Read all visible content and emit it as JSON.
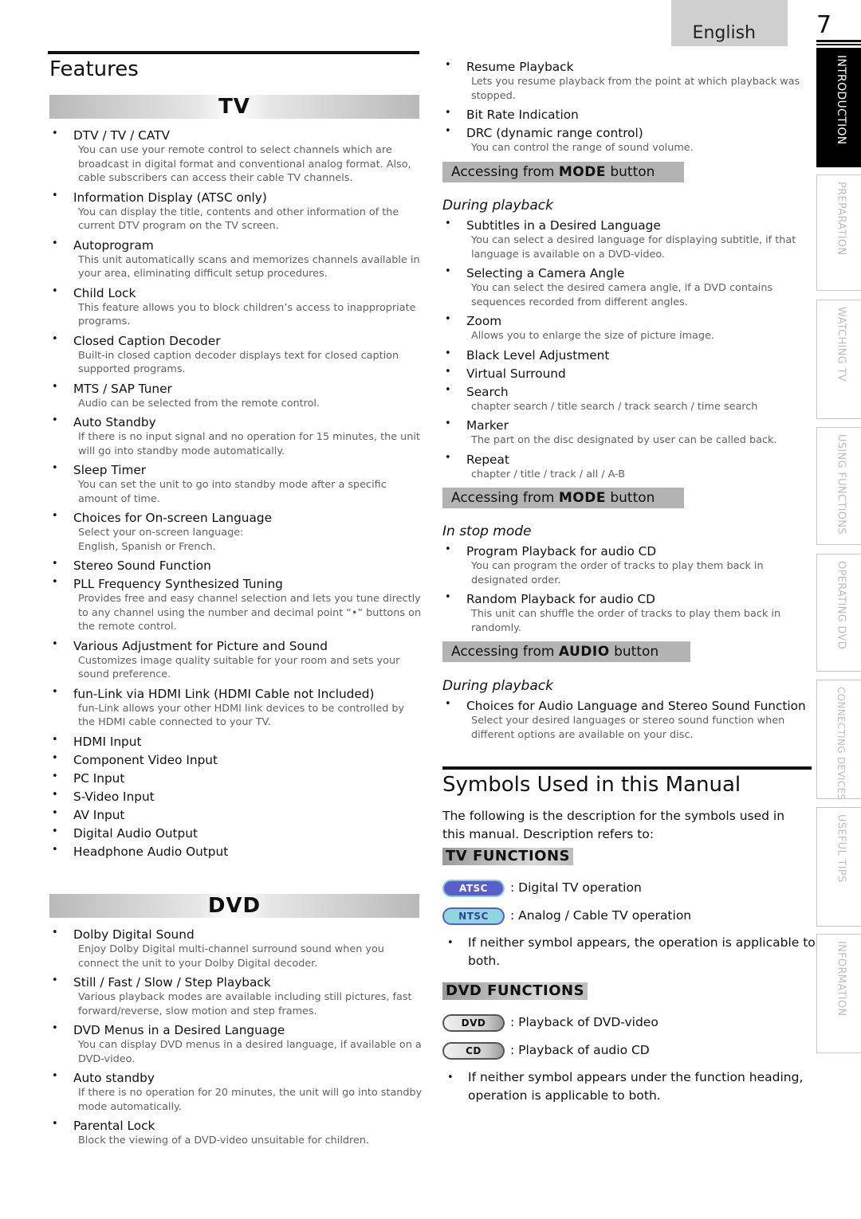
{
  "header": {
    "language_tab": "English",
    "page_number": "7"
  },
  "side_tabs": [
    {
      "label": "INTRODUCTION",
      "active": true
    },
    {
      "label": "PREPARATION",
      "active": false
    },
    {
      "label": "WATCHING TV",
      "active": false
    },
    {
      "label": "USING FUNCTIONS",
      "active": false
    },
    {
      "label": "OPERATING DVD",
      "active": false
    },
    {
      "label": "CONNECTING DEVICES",
      "active": false
    },
    {
      "label": "USEFUL TIPS",
      "active": false
    },
    {
      "label": "INFORMATION",
      "active": false
    }
  ],
  "features": {
    "title": "Features",
    "tv_band": "TV",
    "tv_items": [
      {
        "title": "DTV / TV / CATV",
        "desc": "You can use your remote control to select channels which are broadcast in digital format and conventional analog format. Also, cable subscribers can access their cable TV channels."
      },
      {
        "title": "Information Display",
        "title_extra": " (ATSC only)",
        "desc": "You can display the title, contents and other information of the current DTV program on the TV screen."
      },
      {
        "title": "Autoprogram",
        "desc": "This unit automatically scans and memorizes channels available in your area, eliminating difficult setup procedures."
      },
      {
        "title": "Child Lock",
        "desc": "This feature allows you to block children’s access to inappropriate programs."
      },
      {
        "title": "Closed Caption Decoder",
        "desc": "Built-in closed caption decoder displays text for closed caption supported programs."
      },
      {
        "title": "MTS / SAP Tuner",
        "desc": "Audio can be selected from the remote control."
      },
      {
        "title": "Auto Standby",
        "desc": "If there is no input signal and no operation for 15 minutes, the unit will go into standby mode automatically."
      },
      {
        "title": "Sleep Timer",
        "desc": "You can set the unit to go into standby mode after a specific amount of time."
      },
      {
        "title": "Choices for On-screen Language",
        "desc": "Select your on-screen language:",
        "desc2": "English, Spanish or French."
      },
      {
        "title": "Stereo Sound Function"
      },
      {
        "title": "PLL Frequency Synthesized Tuning",
        "desc": "Provides free and easy channel selection and lets you tune directly to any channel using the number and decimal point “•” buttons on the remote control."
      },
      {
        "title": "Various Adjustment for Picture and Sound",
        "desc": "Customizes image quality suitable for your room and sets your sound preference."
      },
      {
        "title": "fun-Link via HDMI Link",
        "title_extra": " (HDMI Cable not Included)",
        "desc": "fun-Link allows your other HDMI link devices to be controlled by the HDMI cable connected to your TV."
      },
      {
        "title": "HDMI Input"
      },
      {
        "title": "Component Video Input"
      },
      {
        "title": "PC Input"
      },
      {
        "title": "S-Video Input"
      },
      {
        "title": "AV Input"
      },
      {
        "title": "Digital Audio Output"
      },
      {
        "title": "Headphone Audio Output"
      }
    ],
    "dvd_band": "DVD",
    "dvd_items": [
      {
        "title": "Dolby Digital Sound",
        "desc": "Enjoy Dolby Digital multi-channel surround sound when you connect the unit to your Dolby Digital decoder."
      },
      {
        "title": "Still / Fast / Slow / Step Playback",
        "desc": "Various playback modes are available including still pictures, fast forward/reverse, slow motion and step frames."
      },
      {
        "title": "DVD Menus in a Desired Language",
        "desc": "You can display DVD menus in a desired language, if available on a DVD-video."
      },
      {
        "title": "Auto standby",
        "desc": "If there is no operation for 20 minutes, the unit will go into standby mode automatically."
      },
      {
        "title": "Parental Lock",
        "desc": "Block the viewing of a DVD-video unsuitable for children."
      }
    ],
    "dvd_items_cont": [
      {
        "title": "Resume Playback",
        "desc": "Lets you resume playback from the point at which playback was stopped."
      },
      {
        "title": "Bit Rate Indication"
      },
      {
        "title": "DRC (dynamic range control)",
        "desc": "You can control the range of sound volume."
      }
    ],
    "mode_bar_1": {
      "prefix": "Accessing from ",
      "key": "MODE",
      "suffix": " button"
    },
    "during_playback_1": "During playback",
    "mode_items_1": [
      {
        "title": "Subtitles in a Desired Language",
        "desc": "You can select a desired language for displaying subtitle, if that language is available on a DVD-video."
      },
      {
        "title": "Selecting a Camera Angle",
        "desc": "You can select the desired camera angle, if a DVD contains sequences recorded from different angles."
      },
      {
        "title": "Zoom",
        "desc": "Allows you to enlarge the size of picture image."
      },
      {
        "title": "Black Level Adjustment"
      },
      {
        "title": "Virtual Surround"
      },
      {
        "title": "Search",
        "desc": "chapter search / title search / track search / time search"
      },
      {
        "title": "Marker",
        "desc": "The part on the disc designated by user can be called back."
      },
      {
        "title": "Repeat",
        "desc": "chapter / title / track / all / A-B"
      }
    ],
    "mode_bar_2": {
      "prefix": "Accessing from ",
      "key": "MODE",
      "suffix": " button"
    },
    "stop_mode": "In stop mode",
    "mode_items_2": [
      {
        "title": "Program Playback for audio CD",
        "desc": "You can program the order of tracks to play them back in designated order."
      },
      {
        "title": "Random Playback for audio CD",
        "desc": "This unit can shuffle the order of tracks to play them back in randomly."
      }
    ],
    "audio_bar": {
      "prefix": "Accessing from ",
      "key": "AUDIO",
      "suffix": " button"
    },
    "during_playback_2": "During playback",
    "audio_items": [
      {
        "title": "Choices for Audio Language and Stereo Sound Function",
        "desc": "Select your desired languages or stereo sound function when different options are available on your disc."
      }
    ]
  },
  "symbols": {
    "title": "Symbols Used in this Manual",
    "intro": "The following is the description for the symbols used in this manual. Description refers to:",
    "tv_functions_label": "TV FUNCTIONS",
    "tv_symbols": [
      {
        "badge": "ATSC",
        "text": ": Digital TV operation"
      },
      {
        "badge": "NTSC",
        "text": ": Analog / Cable TV operation"
      }
    ],
    "tv_note": "If neither symbol appears, the operation is applicable to both.",
    "dvd_functions_label": "DVD FUNCTIONS",
    "dvd_symbols": [
      {
        "badge": "DVD",
        "text": ": Playback of DVD-video"
      },
      {
        "badge": "CD",
        "text": ": Playback of audio CD"
      }
    ],
    "dvd_note": "If neither symbol appears under the function heading, operation is applicable to both."
  },
  "colors": {
    "atsc_badge": "#5a5ec8",
    "ntsc_badge": "#8fd6e0",
    "section_bar": "#b3b3b3",
    "active_tab": "#000000"
  }
}
